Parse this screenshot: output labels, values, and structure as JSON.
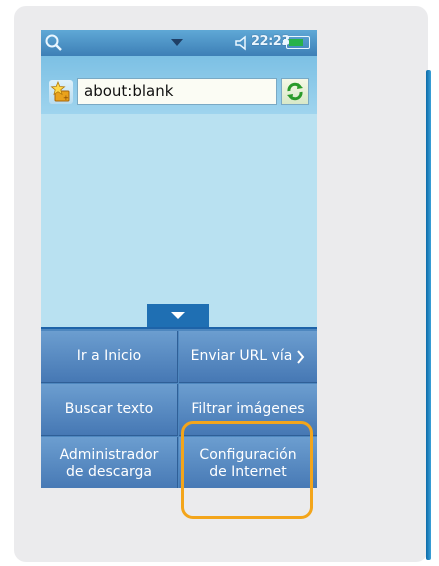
{
  "status_bar": {
    "search_icon": "search-icon",
    "time": "22:23",
    "battery_level": 0.8,
    "battery_color": "#27b24a"
  },
  "browser": {
    "url": "about:blank",
    "favorites_icon": "star-folder-icon",
    "refresh_icon": "refresh-icon"
  },
  "menu": {
    "items": [
      {
        "label": "Ir a Inicio"
      },
      {
        "label": "Enviar URL vía"
      },
      {
        "label": "Buscar texto"
      },
      {
        "label": "Filtrar imágenes"
      },
      {
        "label": "Administrador\nde descarga"
      },
      {
        "label": "Configuración\nde Internet"
      }
    ]
  },
  "colors": {
    "highlight": "#f3a51b",
    "accent": "#1f6fb3"
  }
}
